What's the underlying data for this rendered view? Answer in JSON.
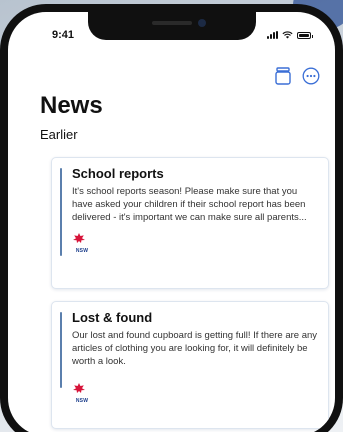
{
  "status_bar": {
    "time": "9:41"
  },
  "header": {
    "title": "News",
    "actions": {
      "archive_icon": "archive-icon",
      "more_icon": "more-icon"
    }
  },
  "section": {
    "label": "Earlier"
  },
  "cards": [
    {
      "title": "School reports",
      "body": "It's school reports season! Please make sure that you have asked your children if their school report has been delivered - it's important we can make sure all parents...",
      "logo_text": "NSW"
    },
    {
      "title": "Lost & found",
      "body": "Our lost and found cupboard is getting full! If there are any articles of clothing you are looking for, it will definitely be worth a look.",
      "logo_text": "NSW"
    }
  ],
  "colors": {
    "accent": "#5b7fad",
    "icon_blue": "#3b6fd6",
    "nsw_red": "#d7153a"
  }
}
